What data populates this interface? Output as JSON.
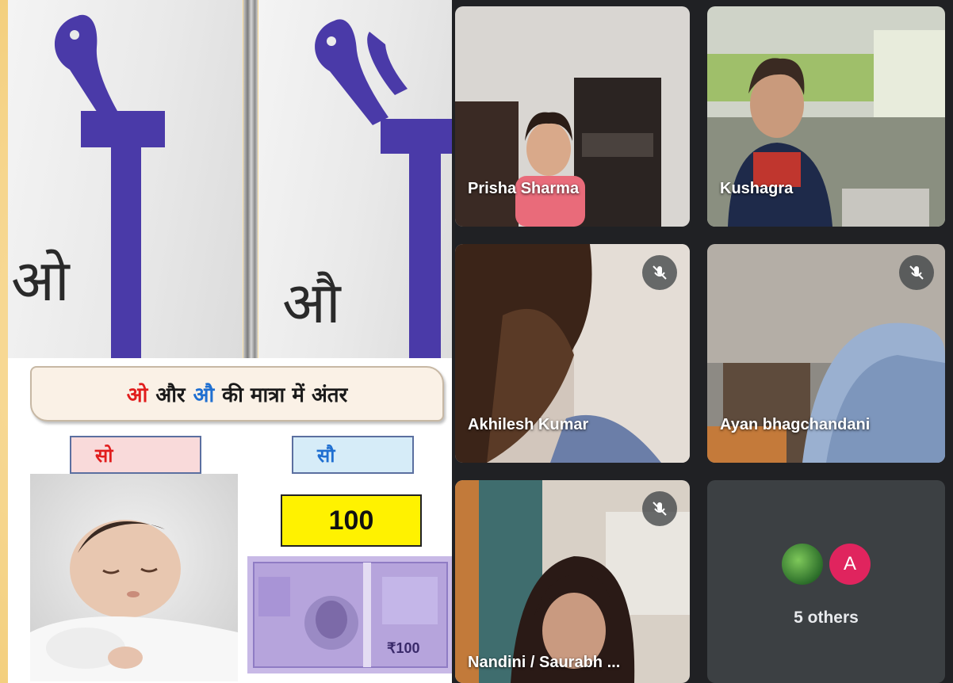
{
  "lesson": {
    "wall_letter_left": "ओ",
    "wall_letter_right": "औ",
    "slide_title": {
      "part1": "ओ",
      "part2": "और",
      "part3": "औ",
      "part4": "की मात्रा में अंतर"
    },
    "word_left": "सो",
    "word_right": "सौ",
    "number": "100",
    "note_value": "₹100"
  },
  "meeting": {
    "participants": [
      {
        "name": "Prisha Sharma",
        "muted": false
      },
      {
        "name": "Kushagra",
        "muted": false
      },
      {
        "name": "Akhilesh Kumar",
        "muted": true
      },
      {
        "name": "Ayan bhagchandani",
        "muted": true
      },
      {
        "name": "Nandini / Saurabh ...",
        "muted": true
      }
    ],
    "others": {
      "avatar_letter": "A",
      "label": "5 others"
    }
  },
  "colors": {
    "matra_purple": "#4a3aa8",
    "meet_bg": "#202124",
    "tile_bg": "#3c4043",
    "avatar_pink": "#e0245e",
    "number_yellow": "#fff200"
  }
}
